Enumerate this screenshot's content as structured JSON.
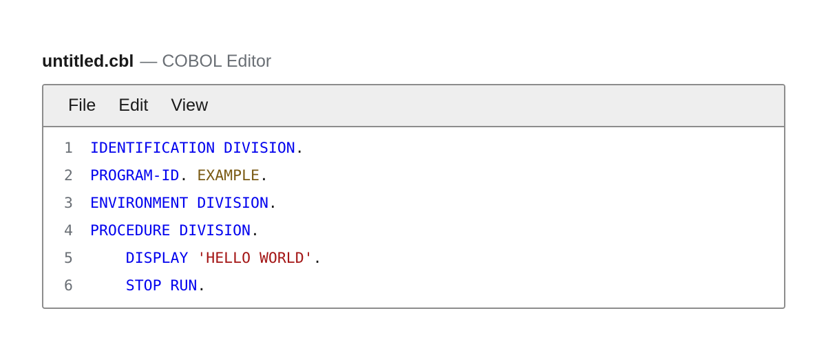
{
  "window": {
    "filename": "untitled.cbl",
    "separator": "—",
    "app_name": "COBOL Editor"
  },
  "menubar": {
    "items": [
      {
        "label": "File"
      },
      {
        "label": "Edit"
      },
      {
        "label": "View"
      }
    ]
  },
  "editor": {
    "language": "COBOL",
    "colors": {
      "keyword": "#0000ee",
      "identifier": "#7a5a14",
      "string": "#a31515",
      "punctuation": "#1a1a1a",
      "line_number": "#6a6f75"
    },
    "lines": [
      {
        "number": "1",
        "indent": "",
        "tokens": [
          {
            "type": "keyword",
            "text": "IDENTIFICATION DIVISION"
          },
          {
            "type": "punct",
            "text": "."
          }
        ]
      },
      {
        "number": "2",
        "indent": "",
        "tokens": [
          {
            "type": "keyword",
            "text": "PROGRAM-ID"
          },
          {
            "type": "punct",
            "text": ". "
          },
          {
            "type": "ident",
            "text": "EXAMPLE"
          },
          {
            "type": "punct",
            "text": "."
          }
        ]
      },
      {
        "number": "3",
        "indent": "",
        "tokens": [
          {
            "type": "keyword",
            "text": "ENVIRONMENT DIVISION"
          },
          {
            "type": "punct",
            "text": "."
          }
        ]
      },
      {
        "number": "4",
        "indent": "",
        "tokens": [
          {
            "type": "keyword",
            "text": "PROCEDURE DIVISION"
          },
          {
            "type": "punct",
            "text": "."
          }
        ]
      },
      {
        "number": "5",
        "indent": "    ",
        "tokens": [
          {
            "type": "keyword",
            "text": "DISPLAY"
          },
          {
            "type": "punct",
            "text": " "
          },
          {
            "type": "string",
            "text": "'HELLO WORLD'"
          },
          {
            "type": "punct",
            "text": "."
          }
        ]
      },
      {
        "number": "6",
        "indent": "    ",
        "tokens": [
          {
            "type": "keyword",
            "text": "STOP RUN"
          },
          {
            "type": "punct",
            "text": "."
          }
        ]
      }
    ]
  }
}
